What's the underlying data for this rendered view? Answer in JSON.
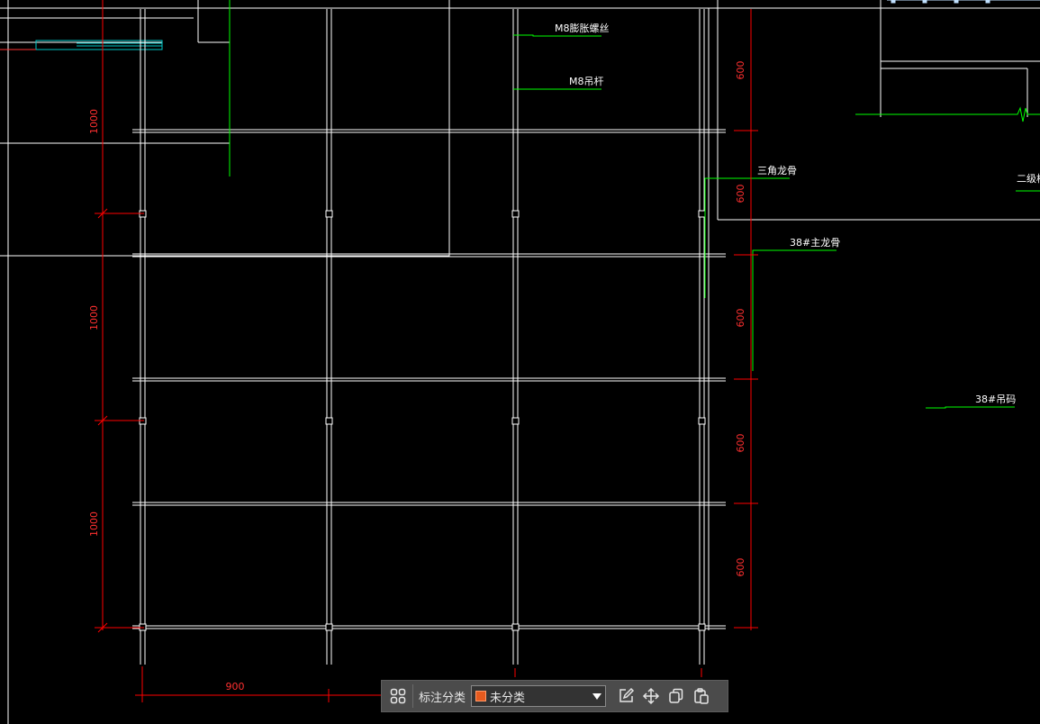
{
  "colors": {
    "background": "#000000",
    "drawing_line": "#ffffff",
    "dimension": "#ff0000",
    "leader": "#00ff00",
    "detail": "#00c8c8",
    "category_swatch": "#e65a1e"
  },
  "annotations": {
    "m8_expansion_bolt": "M8膨胀螺丝",
    "m8_hanger_rod": "M8吊杆",
    "triangle_keel": "三角龙骨",
    "main_keel_38": "38#主龙骨",
    "hanger_38": "38#吊码",
    "secondary_truncated": "二级校"
  },
  "dimensions": {
    "left": [
      "1000",
      "1000",
      "1000"
    ],
    "right": [
      "600",
      "600",
      "600",
      "600",
      "600"
    ],
    "bottom": "900"
  },
  "toolbar": {
    "group_icon": "grid-group-icon",
    "label": "标注分类",
    "selected_category": "未分类",
    "edit_icon": "edit-icon",
    "move_icon": "move-icon",
    "copy_icon": "copy-icon",
    "paste_icon": "paste-icon"
  }
}
